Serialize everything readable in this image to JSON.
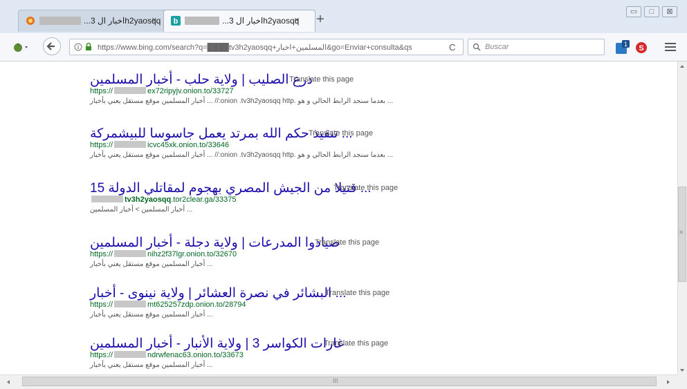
{
  "tabs": [
    {
      "title": "...اخبار ال 3h2yaosqq",
      "close": "×"
    },
    {
      "title": "...اخبار ال 3h2yaosqq",
      "close": "×"
    }
  ],
  "new_tab_label": "+",
  "window_controls": {
    "minimize": "▭",
    "maximize": "□",
    "close": "⊠"
  },
  "navbar": {
    "url": "https://www.bing.com/search?q=████tv3h2yaosqq+المسلمين+اخبار&go=Enviar+consulta&qs",
    "search_placeholder": "Buscar",
    "reload": "C"
  },
  "results": [
    {
      "title": "درع الصليب | ولاية حلب - أخبار المسلمين",
      "translate": "Translate this page",
      "url_prefix": "https://",
      "url_suffix": "ex72ripyjv.onion.to/33727",
      "snippet": "... بعدما سنجد الرابط الحالي و هو .onion .tv3h2yaosqq http:// ... أخبار المسلمين موقع مستقل يعني بأخبار"
    },
    {
      "title": "... تنفيذ حكم الله بمرتد يعمل جاسوسا للبيشمركة",
      "translate": "Translate this page",
      "url_prefix": "https://",
      "url_suffix": "icvc45xk.onion.to/33646",
      "snippet": "... بعدما سنجد الرابط الحالي و هو .onion .tv3h2yaosqq http:// ... أخبار المسلمين موقع مستقل يعني بأخبار"
    },
    {
      "title": "... قتيلا من الجيش المصري بهجوم لمقاتلي الدولة 15",
      "translate": "Translate this page",
      "url_prefix": "",
      "url_bold": "tv3h2yaosqq",
      "url_suffix": ".tor2clear.ga/33375",
      "snippet": "... أخبار المسلمين > أخبار المسلمين"
    },
    {
      "title": "صيادوا المدرعات | ولاية دجلة - أخبار المسلمين",
      "translate": "Translate this page",
      "url_prefix": "https://",
      "url_suffix": "nihz2f37lgr.onion.to/32670",
      "snippet": "... أخبار المسلمين موقع مستقل يعني بأخبار"
    },
    {
      "title": "... البشائر في نصرة العشائر | ولاية نينوى - أخبار",
      "translate": "Translate this page",
      "url_prefix": "https://",
      "url_suffix": "mt625257zdp.onion.to/28794",
      "snippet": "... أخبار المسلمين موقع مستقل يعني بأخبار"
    },
    {
      "title": "غارات الكواسر 3 | ولاية الأنبار - أخبار المسلمين",
      "translate": "Translate this page",
      "url_prefix": "https://",
      "url_suffix": "ndrwfenac63.onion.to/33673",
      "snippet": "... أخبار المسلمين موقع مستقل يعني بأخبار"
    }
  ],
  "scroll": {
    "h_label": "III",
    "v_label": "≡"
  }
}
